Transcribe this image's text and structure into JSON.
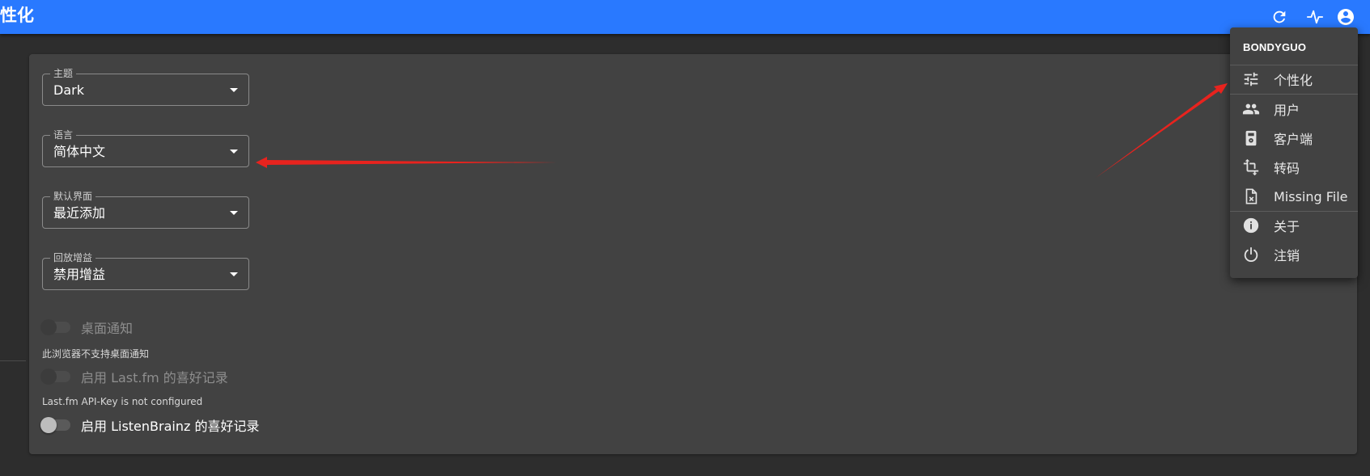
{
  "appbar": {
    "title": "性化",
    "icons": [
      "refresh-icon",
      "activity-icon",
      "account-circle-icon"
    ]
  },
  "settings": {
    "theme": {
      "label": "主题",
      "value": "Dark"
    },
    "language": {
      "label": "语言",
      "value": "简体中文"
    },
    "default_view": {
      "label": "默认界面",
      "value": "最近添加"
    },
    "replay_gain": {
      "label": "回放增益",
      "value": "禁用增益"
    },
    "desktop_notifications": {
      "label": "桌面通知",
      "enabled": false,
      "disabled": true,
      "helper": "此浏览器不支持桌面通知"
    },
    "lastfm_scrobble": {
      "label": "启用 Last.fm 的喜好记录",
      "enabled": false,
      "disabled": true,
      "helper": "Last.fm API-Key is not configured"
    },
    "listenbrainz_scrobble": {
      "label": "启用 ListenBrainz 的喜好记录",
      "enabled": false,
      "disabled": false
    }
  },
  "user_menu": {
    "username": "BONDYGUO",
    "items": [
      {
        "label": "个性化",
        "icon": "tune-icon"
      },
      {
        "label": "用户",
        "icon": "people-icon"
      },
      {
        "label": "客户端",
        "icon": "player-icon"
      },
      {
        "label": "转码",
        "icon": "transform-icon"
      },
      {
        "label": "Missing File",
        "icon": "missing-file-icon"
      },
      {
        "label": "关于",
        "icon": "info-icon"
      },
      {
        "label": "注销",
        "icon": "power-icon"
      }
    ]
  },
  "colors": {
    "appbar": "#2979ff",
    "background": "#2d2d2d",
    "card": "#424242",
    "annotation_arrow": "#e8231e"
  }
}
